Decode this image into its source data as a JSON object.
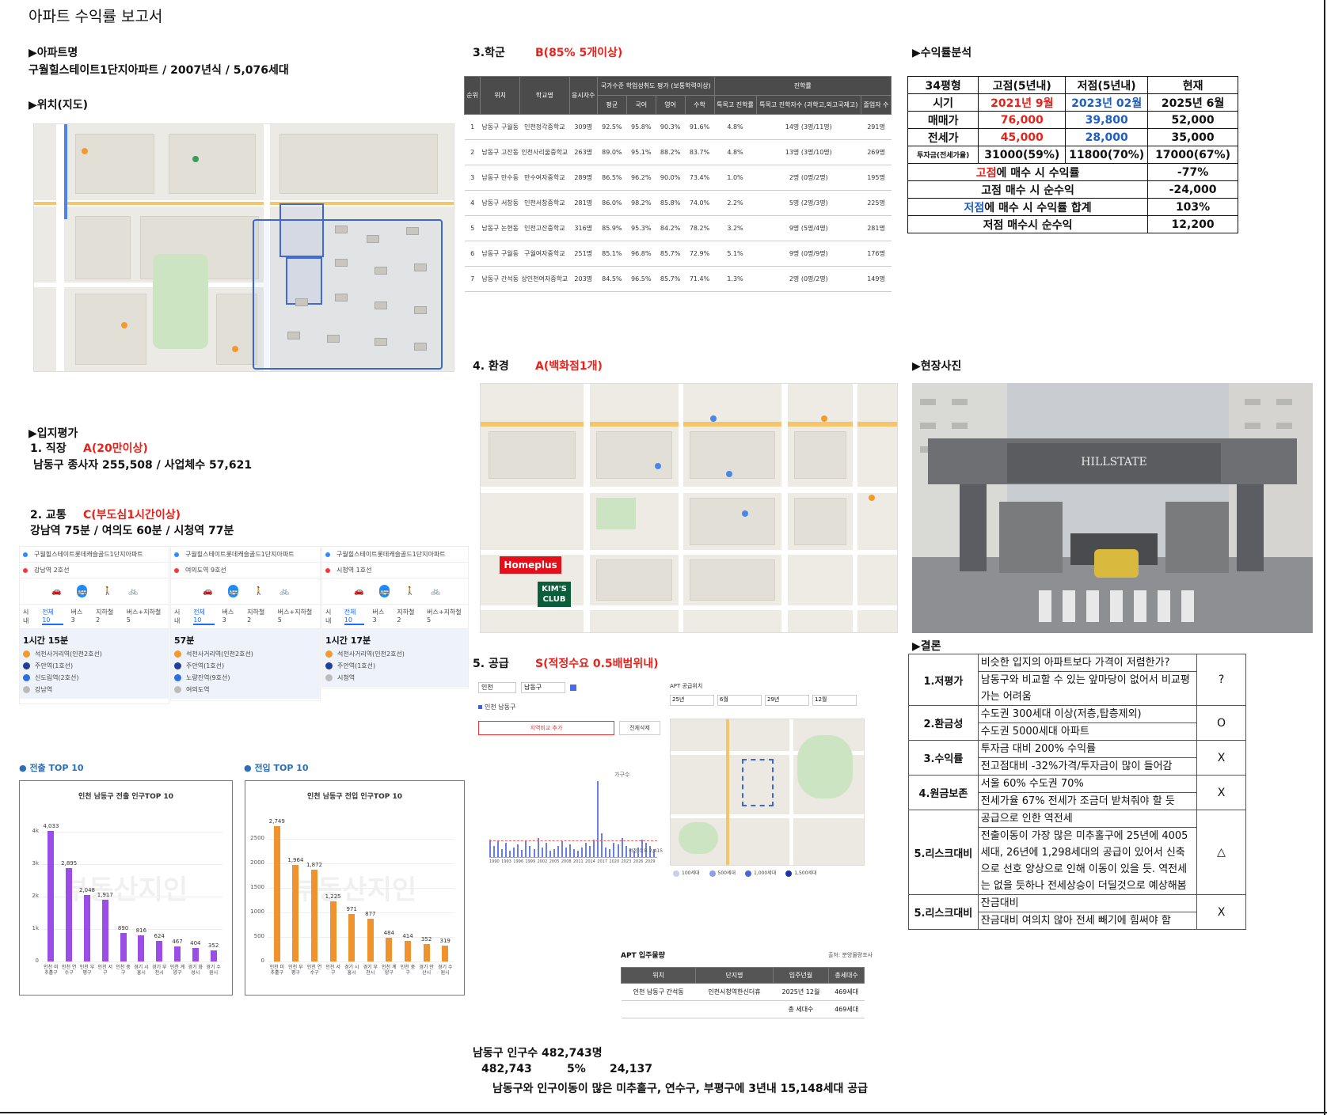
{
  "title": "아파트 수익률 보고서",
  "apt": {
    "header": "▶아파트명",
    "desc": "구월힐스테이트1단지아파트 / 2007년식 / 5,076세대"
  },
  "location": {
    "header": "▶위치(지도)"
  },
  "eval": {
    "header": "▶입지평가",
    "job_label": "1. 직장",
    "job_grade": "A(20만이상)",
    "job_desc": "남동구 종사자 255,508 / 사업체수 57,621",
    "traffic_label": "2. 교통",
    "traffic_grade": "C(부도심1시간이상)",
    "traffic_desc": "강남역 75분 / 여의도 60분 / 시청역 77분"
  },
  "routes": [
    {
      "from": "구월힐스테이트롯데캐슬골드1단지아파트",
      "to": "강남역 2호선",
      "time": "1시간 15분",
      "steps": [
        "석천사거리역(인천2호선)",
        "주안역(1호선)",
        "신도림역(2호선)",
        "강남역"
      ]
    },
    {
      "from": "구월힐스테이트롯데캐슬골드1단지아파트",
      "to": "여의도역 9호선",
      "time": "57분",
      "steps": [
        "석천사거리역(인천2호선)",
        "주안역(1호선)",
        "노량진역(9호선)",
        "여의도역"
      ]
    },
    {
      "from": "구월힐스테이트롯데캐슬골드1단지아파트",
      "to": "시청역 1호선",
      "time": "1시간 17분",
      "steps": [
        "석천사거리역(인천2호선)",
        "주안역(1호선)",
        "시청역"
      ]
    }
  ],
  "route_tabs": [
    "시내",
    "전체 10",
    "버스 3",
    "지하철 2",
    "버스+지하철 5"
  ],
  "charts": {
    "out_head": "전출 TOP 10",
    "in_head": "전입 TOP 10",
    "watermark": "부동산지인"
  },
  "chart_data": [
    {
      "type": "bar",
      "title": "인천 남동구 전출 인구TOP 10",
      "categories": [
        "인천 미추홀구",
        "인천 연수구",
        "인천 부평구",
        "인천 서구",
        "인천 중구",
        "경기 시흥시",
        "경기 부천시",
        "인천 계양구",
        "경기 화성시",
        "경기 수원시"
      ],
      "values": [
        4033,
        2895,
        2048,
        1917,
        890,
        816,
        624,
        467,
        404,
        352
      ],
      "yticks": [
        "0",
        "1k",
        "2k",
        "3k",
        "4k"
      ],
      "ylim": [
        0,
        4400
      ],
      "color": "#9b4de8"
    },
    {
      "type": "bar",
      "title": "인천 남동구 전입 인구TOP 10",
      "categories": [
        "인천 미추홀구",
        "인천 부평구",
        "인천 연수구",
        "인천 서구",
        "경기 시흥시",
        "경기 부천시",
        "인천 계양구",
        "인천 중구",
        "경기 안산시",
        "경기 수원시"
      ],
      "values": [
        2749,
        1964,
        1872,
        1225,
        971,
        877,
        484,
        414,
        352,
        319
      ],
      "yticks": [
        "0",
        "500",
        "1000",
        "1500",
        "2000",
        "2500"
      ],
      "ylim": [
        0,
        2900
      ],
      "color": "#f0922e"
    }
  ],
  "school": {
    "label": "3.학군",
    "grade": "B(85% 5개이상)",
    "head_main": [
      "순위",
      "위치",
      "학교명",
      "응시자수"
    ],
    "head_group1": "국가수준 학업성취도 평가 (보통학력이상)",
    "head_group1_sub": [
      "평균",
      "국어",
      "영어",
      "수학"
    ],
    "head_group2": "진학률",
    "head_group2_sub": [
      "특목고 진학률",
      "특목고 진학자수 (과학고,외고국제고)",
      "졸업자 수"
    ],
    "rows": [
      [
        "1",
        "남동구 구월동",
        "인천정각중학교",
        "309명",
        "92.5%",
        "95.8%",
        "90.3%",
        "91.6%",
        "4.8%",
        "14명 (3명/11명)",
        "291명"
      ],
      [
        "2",
        "남동구 고잔동",
        "인천사리울중학교",
        "263명",
        "89.0%",
        "95.1%",
        "88.2%",
        "83.7%",
        "4.8%",
        "13명 (3명/10명)",
        "269명"
      ],
      [
        "3",
        "남동구 만수동",
        "만수여자중학교",
        "289명",
        "86.5%",
        "96.2%",
        "90.0%",
        "73.4%",
        "1.0%",
        "2명 (0명/2명)",
        "195명"
      ],
      [
        "4",
        "남동구 서창동",
        "인천서창중학교",
        "281명",
        "86.0%",
        "98.2%",
        "85.8%",
        "74.0%",
        "2.2%",
        "5명 (2명/3명)",
        "225명"
      ],
      [
        "5",
        "남동구 논현동",
        "인천고잔중학교",
        "316명",
        "85.9%",
        "95.3%",
        "84.2%",
        "78.2%",
        "3.2%",
        "9명 (5명/4명)",
        "281명"
      ],
      [
        "6",
        "남동구 구월동",
        "구월여자중학교",
        "251명",
        "85.1%",
        "96.8%",
        "85.7%",
        "72.9%",
        "5.1%",
        "9명 (0명/9명)",
        "176명"
      ],
      [
        "7",
        "남동구 간석동",
        "상인천여자중학교",
        "203명",
        "84.5%",
        "96.5%",
        "85.7%",
        "71.4%",
        "1.3%",
        "2명 (0명/2명)",
        "149명"
      ]
    ]
  },
  "env": {
    "label": "4. 환경",
    "grade": "A(백화점1개)",
    "homeplus": "Homeplus",
    "kims_line1": "KIM'S",
    "kims_line2": "CLUB"
  },
  "supply": {
    "label": "5. 공급",
    "grade": "S(적정수요 0.5배범위내)",
    "region_select": [
      "인천",
      "남동구"
    ],
    "region_tag": "인천 남동구",
    "add_btn": "지역비교 추가",
    "del_btn": "전체삭제",
    "map_title": "APT 공급위치",
    "map_filters": [
      "25년",
      "6월",
      "29년",
      "12월"
    ],
    "note": "적정 수요 2,415",
    "xticks": [
      "1990",
      "1993",
      "1996",
      "1999",
      "2002",
      "2005",
      "2008",
      "2011",
      "2014",
      "2017",
      "2020",
      "2023",
      "2026",
      "2029"
    ],
    "legend": [
      "100세대",
      "500세대",
      "1,000세대",
      "1,500세대"
    ],
    "occ_title": "APT 입주물량",
    "occ_src": "출처: 분양물량조사",
    "occ_head": [
      "위치",
      "단지명",
      "입주년월",
      "총세대수"
    ],
    "occ_rows": [
      [
        "인천 남동구 간석동",
        "인천시청역한신더휴",
        "2025년 12월",
        "469세대"
      ],
      [
        "",
        "",
        "총 세대수",
        "469세대"
      ]
    ],
    "pop1": "남동구 인구수 482,743명",
    "pop2a": "482,743",
    "pop2b": "5%",
    "pop2c": "24,137",
    "pop3": "남동구와 인구이동이 많은 미추홀구, 연수구, 부평구에 3년내 15,148세대 공급"
  },
  "yield": {
    "header": "▶수익률분석",
    "col_heads": [
      "34평형",
      "고점(5년내)",
      "저점(5년내)",
      "현재"
    ],
    "rows": [
      [
        "시기",
        "2021년 9월",
        "2023년 02월",
        "2025년 6월"
      ],
      [
        "매매가",
        "76,000",
        "39,800",
        "52,000"
      ],
      [
        "전세가",
        "45,000",
        "28,000",
        "35,000"
      ],
      [
        "투자금(전세가율)",
        "31000(59%)",
        "11800(70%)",
        "17000(67%)"
      ]
    ],
    "summary": [
      {
        "pre": "고점",
        "rest": "에 매수 시 수익률",
        "val": "-77%"
      },
      {
        "pre": "",
        "rest": "고점 매수 시 순수익",
        "val": "-24,000"
      },
      {
        "pre": "저점",
        "rest": "에 매수 시 수익률 합계",
        "val": "103%"
      },
      {
        "pre": "",
        "rest": "저점 매수시 순수익",
        "val": "12,200"
      }
    ]
  },
  "photo": {
    "header": "▶현장사진",
    "gate_text": "HILLSTATE"
  },
  "conclusion": {
    "header": "▶결론",
    "rows": [
      {
        "key": "1.저평가",
        "lines": [
          "비슷한 입지의 아파트보다 가격이 저렴한가?",
          "남동구와 비교할 수 있는 앞마당이 없어서 비교평가는 어려움"
        ],
        "mark": "?"
      },
      {
        "key": "2.환금성",
        "lines": [
          "수도권 300세대 이상(저층,탑층제외)",
          "수도권 5000세대 아파트"
        ],
        "mark": "O"
      },
      {
        "key": "3.수익률",
        "lines": [
          "투자금 대비 200% 수익률",
          "전고점대비 -32%가격/투자금이 많이 들어감"
        ],
        "mark": "X"
      },
      {
        "key": "4.원금보존",
        "lines": [
          "서울 60% 수도권 70%",
          "전세가율 67% 전세가 조금더 받쳐줘야 할 듯"
        ],
        "mark": "X"
      },
      {
        "key": "5.리스크대비",
        "lines": [
          "공급으로 인한 역전세",
          "전출이동이 가장 많은 미추홀구에 25년에 4005세대, 26년에 1,298세대의 공급이 있어서 신축으로 선호 양상으로 인해 이동이 있을 듯. 역전세는 없을 듯하나 전세상승이 더딜것으로 예상해봄"
        ],
        "mark": "△"
      },
      {
        "key": "5.리스크대비",
        "lines": [
          "잔금대비",
          "잔금대비 여의치 않아 전세 빼기에 힘써야 함"
        ],
        "mark": "X"
      }
    ]
  }
}
